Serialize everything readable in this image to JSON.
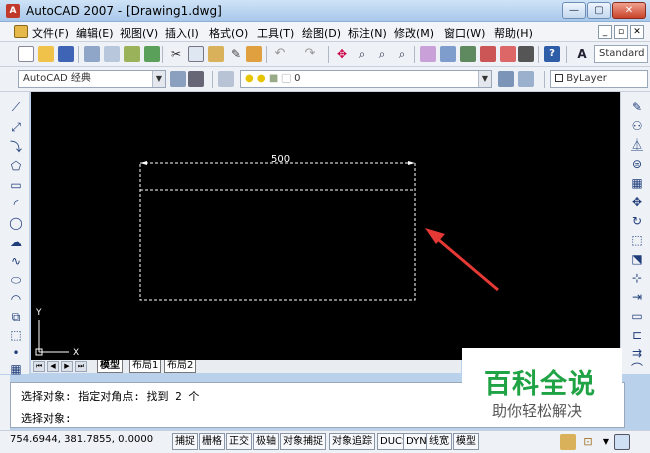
{
  "window": {
    "title": "AutoCAD 2007 - [Drawing1.dwg]"
  },
  "menu": {
    "items": [
      "文件(F)",
      "编辑(E)",
      "视图(V)",
      "插入(I)",
      "格式(O)",
      "工具(T)",
      "绘图(D)",
      "标注(N)",
      "修改(M)",
      "窗口(W)",
      "帮助(H)"
    ]
  },
  "toolbar": {
    "text_style": "Standard",
    "workspace": "AutoCAD 经典",
    "layer": "0",
    "color": "ByLayer"
  },
  "canvas": {
    "dimension_text": "500",
    "ucs_x": "X",
    "ucs_y": "Y"
  },
  "tabs": [
    "模型",
    "布局1",
    "布局2"
  ],
  "command": {
    "line1": "选择对象: 指定对角点: 找到 2 个",
    "line2": "选择对象:"
  },
  "status": {
    "coords": "754.6944, 381.7855, 0.0000",
    "buttons": [
      "捕捉",
      "栅格",
      "正交",
      "极轴",
      "对象捕捉",
      "对象追踪",
      "DUCS",
      "DYN",
      "线宽",
      "模型"
    ]
  },
  "watermark": {
    "title": "百科全说",
    "subtitle": "助你轻松解决"
  },
  "colors": {
    "selection": "#ffffff",
    "arrow": "#e53935",
    "watermark": "#1fa345"
  }
}
